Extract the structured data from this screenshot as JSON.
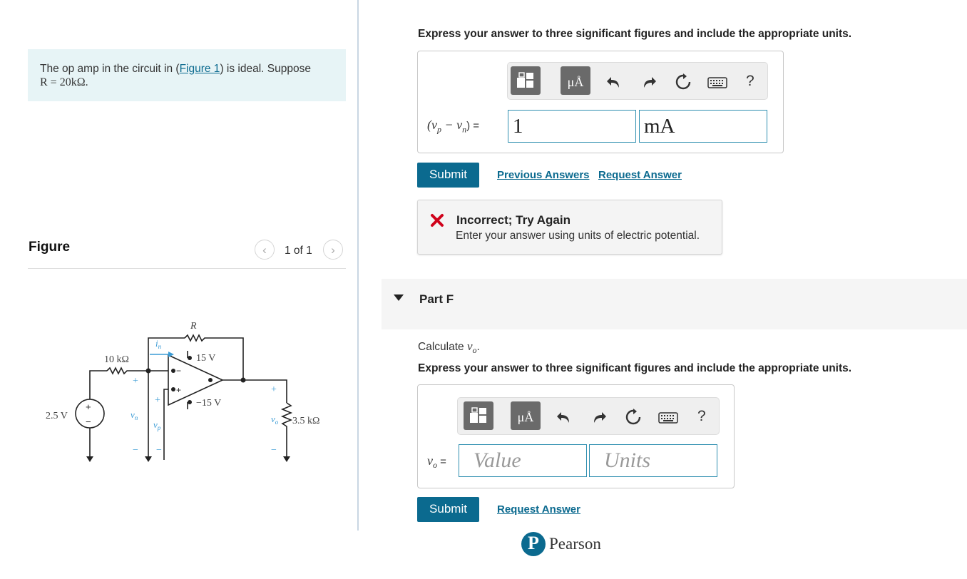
{
  "problem": {
    "text_before": "The op amp in the circuit in (",
    "figure_link": "Figure 1",
    "text_after": ") is ideal. Suppose",
    "given": "R = 20kΩ."
  },
  "figure": {
    "heading": "Figure",
    "page_count": "1 of 1",
    "prev_icon": "chevron-left",
    "next_icon": "chevron-right"
  },
  "circuit": {
    "R_label": "R",
    "r1_label": "10 kΩ",
    "source_label": "2.5 V",
    "pos_supply": "15 V",
    "neg_supply": "−15 V",
    "load_label": "3.5 kΩ",
    "in_label": "i",
    "in_sub": "n",
    "vn_label": "v",
    "vn_sub": "n",
    "vp_label": "v",
    "vp_sub": "p",
    "vo_label": "v",
    "vo_sub": "o",
    "plus": "+",
    "minus": "−"
  },
  "part_e": {
    "instruction": "Express your answer to three significant figures and include the appropriate units.",
    "expr_left": "(v",
    "expr_p": "p",
    "expr_mid": " − v",
    "expr_n": "n",
    "expr_right": ") =",
    "value": "1",
    "units": "mA",
    "submit_label": "Submit",
    "previous_answers_label": "Previous Answers",
    "request_answer_label": "Request Answer",
    "feedback_title": "Incorrect; Try Again",
    "feedback_message": "Enter your answer using units of electric potential."
  },
  "toolbar": {
    "units_button_label": "μÅ",
    "help_label": "?",
    "icons": [
      "templates-icon",
      "units-icon",
      "undo-icon",
      "redo-icon",
      "reset-icon",
      "keyboard-icon",
      "help-icon"
    ]
  },
  "part_f": {
    "heading": "Part F",
    "prompt_prefix": "Calculate ",
    "prompt_var": "v",
    "prompt_sub": "o",
    "prompt_suffix": ".",
    "instruction": "Express your answer to three significant figures and include the appropriate units.",
    "label_var": "v",
    "label_sub": "o",
    "label_eq": " =",
    "value_placeholder": "Value",
    "units_placeholder": "Units",
    "submit_label": "Submit",
    "request_answer_label": "Request Answer"
  },
  "footer": {
    "brand": "Pearson",
    "logo_letter": "P"
  },
  "colors": {
    "accent": "#0b6a8f",
    "problem_bg": "#e7f4f6",
    "error": "#d0021b"
  }
}
